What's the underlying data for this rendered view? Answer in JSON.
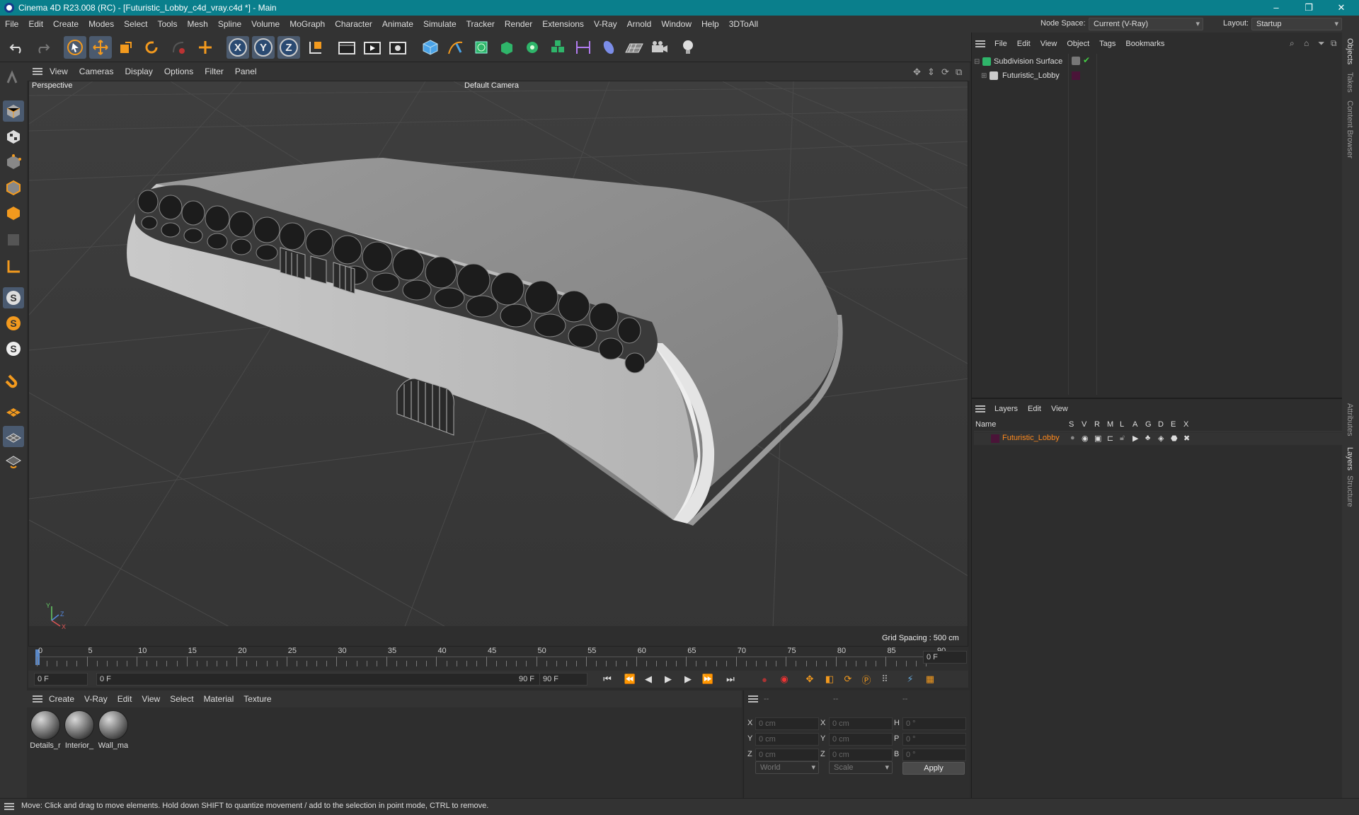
{
  "window": {
    "title": "Cinema 4D R23.008 (RC) - [Futuristic_Lobby_c4d_vray.c4d *] - Main",
    "minimize": "–",
    "restore": "❐",
    "close": "✕"
  },
  "menu": [
    "File",
    "Edit",
    "Create",
    "Modes",
    "Select",
    "Tools",
    "Mesh",
    "Spline",
    "Volume",
    "MoGraph",
    "Character",
    "Animate",
    "Simulate",
    "Tracker",
    "Render",
    "Extensions",
    "V-Ray",
    "Arnold",
    "Window",
    "Help",
    "3DToAll"
  ],
  "node_space": {
    "label": "Node Space:",
    "value": "Current (V-Ray)"
  },
  "layout": {
    "label": "Layout:",
    "value": "Startup"
  },
  "toolbar": {
    "x": "X",
    "y": "Y",
    "z": "Z"
  },
  "viewport": {
    "menu": [
      "View",
      "Cameras",
      "Display",
      "Options",
      "Filter",
      "Panel"
    ],
    "name": "Perspective",
    "camera": "Default Camera",
    "grid_spacing": "Grid Spacing : 500 cm",
    "axis_x": "X",
    "axis_y": "Y",
    "axis_z": "Z"
  },
  "timeline": {
    "ticks": [
      "0",
      "5",
      "10",
      "15",
      "20",
      "25",
      "30",
      "35",
      "40",
      "45",
      "50",
      "55",
      "60",
      "65",
      "70",
      "75",
      "80",
      "85",
      "90"
    ],
    "current_frame": "0 F",
    "start": "0 F",
    "range_start": "0 F",
    "range_end": "90 F",
    "end": "90 F"
  },
  "material_menu": [
    "Create",
    "V-Ray",
    "Edit",
    "View",
    "Select",
    "Material",
    "Texture"
  ],
  "materials": [
    {
      "name": "Details_r"
    },
    {
      "name": "Interior_"
    },
    {
      "name": "Wall_ma"
    }
  ],
  "coords": {
    "headers": [
      "--",
      "--",
      "--"
    ],
    "x": "X",
    "y": "Y",
    "z": "Z",
    "h": "H",
    "p": "P",
    "b": "B",
    "pos": "0 cm",
    "rot": "0 °",
    "world": "World",
    "scale": "Scale",
    "apply": "Apply"
  },
  "objects": {
    "menu": [
      "File",
      "Edit",
      "View",
      "Object",
      "Tags",
      "Bookmarks"
    ],
    "items": [
      {
        "name": "Subdivision Surface"
      },
      {
        "name": "Futuristic_Lobby"
      }
    ]
  },
  "layers": {
    "menu": [
      "Layers",
      "Edit",
      "View"
    ],
    "columns": [
      "Name",
      "S",
      "V",
      "R",
      "M",
      "L",
      "A",
      "G",
      "D",
      "E",
      "X"
    ],
    "items": [
      {
        "name": "Futuristic_Lobby",
        "color": "#ff8a1e"
      }
    ]
  },
  "right_tabs": [
    "Objects",
    "Takes",
    "Content Browser",
    "Attributes",
    "Layers",
    "Structure"
  ],
  "status": "Move: Click and drag to move elements. Hold down SHIFT to quantize movement / add to the selection in point mode, CTRL to remove."
}
